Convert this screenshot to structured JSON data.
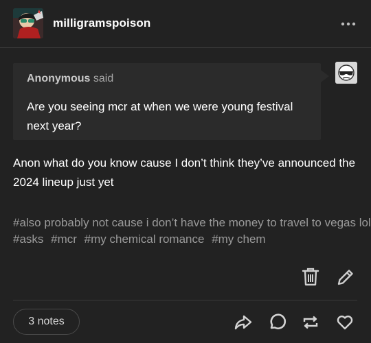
{
  "post": {
    "blog_name": "milligramspoison",
    "ask": {
      "asker_name": "Anonymous",
      "asker_said": "said",
      "question": "Are you seeing mcr at when we were young festival next year?"
    },
    "answer": "Anon what do you know cause I don’t think they’ve announced the 2024 lineup just yet",
    "tags": [
      "#also probably not cause i don’t have the money to travel to vegas lol",
      "#asks",
      "#mcr",
      "#my chemical romance",
      "#my chem"
    ],
    "notes_label": "3 notes"
  },
  "icons": {
    "more": "more-horizontal-icon",
    "delete": "trash-icon",
    "edit": "pencil-icon",
    "share": "share-arrow-icon",
    "reply": "speech-bubble-icon",
    "reblog": "reblog-icon",
    "like": "heart-icon"
  },
  "colors": {
    "background": "#222222",
    "text": "#ffffff",
    "tag_text": "#9a9a9a",
    "ask_bubble": "#2b2b2b"
  }
}
